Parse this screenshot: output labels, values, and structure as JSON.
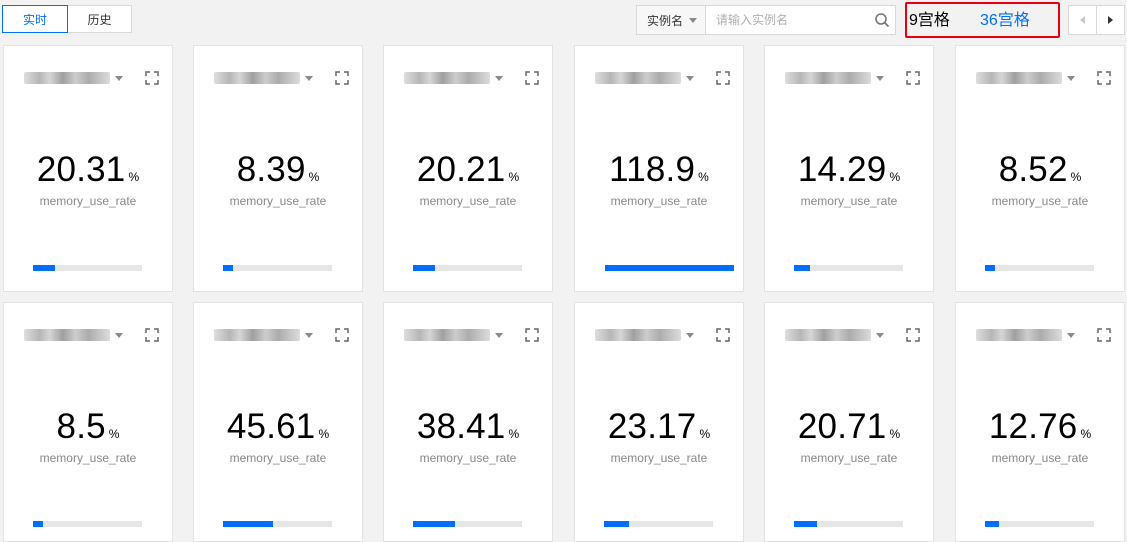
{
  "toolbar": {
    "mode_tabs": [
      {
        "label": "实时",
        "active": true
      },
      {
        "label": "历史",
        "active": false
      }
    ],
    "search": {
      "field_label": "实例名",
      "placeholder": "请输入实例名",
      "value": ""
    },
    "grid_options": [
      {
        "label": "9宫格",
        "active": false
      },
      {
        "label": "36宫格",
        "active": true
      }
    ],
    "pager": {
      "prev_icon": "chevron-left-icon",
      "next_icon": "chevron-right-icon"
    }
  },
  "colors": {
    "accent": "#006eff",
    "highlight_border": "#e60012",
    "bar_track": "#e6e6e6"
  },
  "cards": [
    {
      "value": "20.31",
      "unit": "%",
      "metric": "memory_use_rate",
      "fill": 0.2031
    },
    {
      "value": "8.39",
      "unit": "%",
      "metric": "memory_use_rate",
      "fill": 0.0839
    },
    {
      "value": "20.21",
      "unit": "%",
      "metric": "memory_use_rate",
      "fill": 0.2021
    },
    {
      "value": "118.9",
      "unit": "%",
      "metric": "memory_use_rate",
      "fill": 1.0
    },
    {
      "value": "14.29",
      "unit": "%",
      "metric": "memory_use_rate",
      "fill": 0.1429
    },
    {
      "value": "8.52",
      "unit": "%",
      "metric": "memory_use_rate",
      "fill": 0.0852
    },
    {
      "value": "8.5",
      "unit": "%",
      "metric": "memory_use_rate",
      "fill": 0.085
    },
    {
      "value": "45.61",
      "unit": "%",
      "metric": "memory_use_rate",
      "fill": 0.4561
    },
    {
      "value": "38.41",
      "unit": "%",
      "metric": "memory_use_rate",
      "fill": 0.3841
    },
    {
      "value": "23.17",
      "unit": "%",
      "metric": "memory_use_rate",
      "fill": 0.2317
    },
    {
      "value": "20.71",
      "unit": "%",
      "metric": "memory_use_rate",
      "fill": 0.2071
    },
    {
      "value": "12.76",
      "unit": "%",
      "metric": "memory_use_rate",
      "fill": 0.1276
    }
  ]
}
